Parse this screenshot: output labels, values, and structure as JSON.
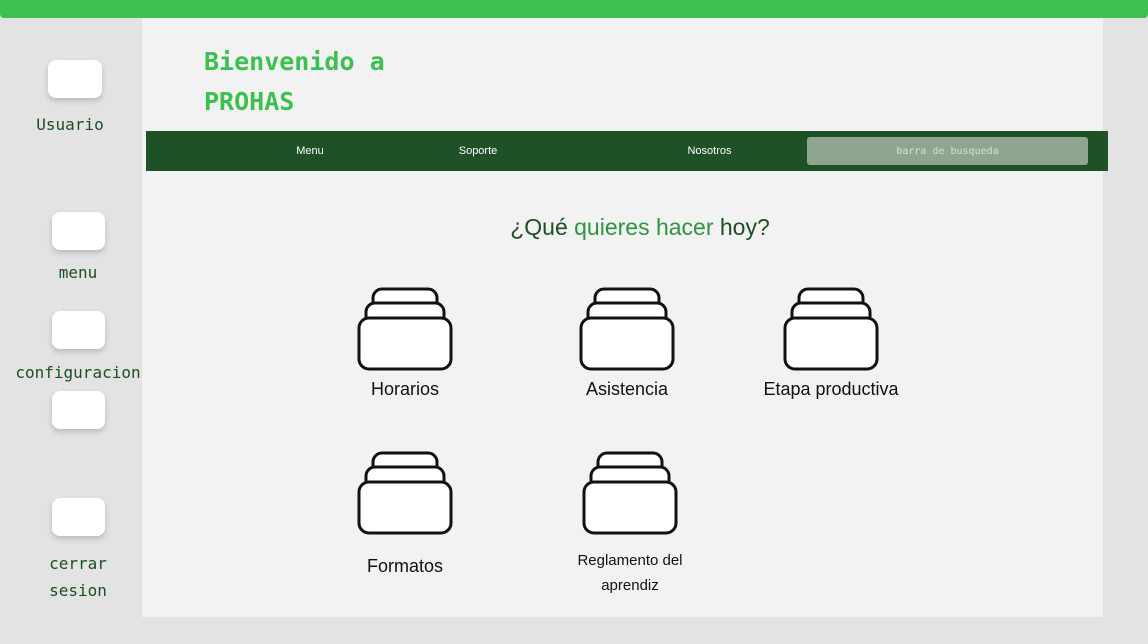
{
  "header": {
    "title_line1": "Bienvenido a",
    "title_line2": "PROHAS"
  },
  "sidebar": {
    "items": [
      {
        "label": "Usuario"
      },
      {
        "label": "menu"
      },
      {
        "label": "configuracion"
      },
      {
        "label": ""
      },
      {
        "label_line1": "cerrar",
        "label_line2": "sesion"
      }
    ]
  },
  "nav": {
    "items": [
      "Menu",
      "Soporte",
      "Nosotros"
    ],
    "search_placeholder": "barra de busqueda"
  },
  "main": {
    "question_part1": "¿Qué ",
    "question_part2": "quieres hacer",
    "question_part3": " hoy?",
    "options": [
      {
        "label": "Horarios",
        "icon": "folder-stack-icon"
      },
      {
        "label": "Asistencia",
        "icon": "folder-stack-icon"
      },
      {
        "label": "Etapa  productiva",
        "icon": "folder-stack-icon"
      },
      {
        "label": "Formatos",
        "icon": "folder-stack-icon"
      },
      {
        "label_line1": "Reglamento del",
        "label_line2": "aprendiz",
        "icon": "folder-stack-icon"
      }
    ]
  },
  "colors": {
    "accent": "#3cc04f",
    "nav_bg": "#1e5126",
    "dark_text": "#1d4e24",
    "highlight": "#2e9442"
  }
}
